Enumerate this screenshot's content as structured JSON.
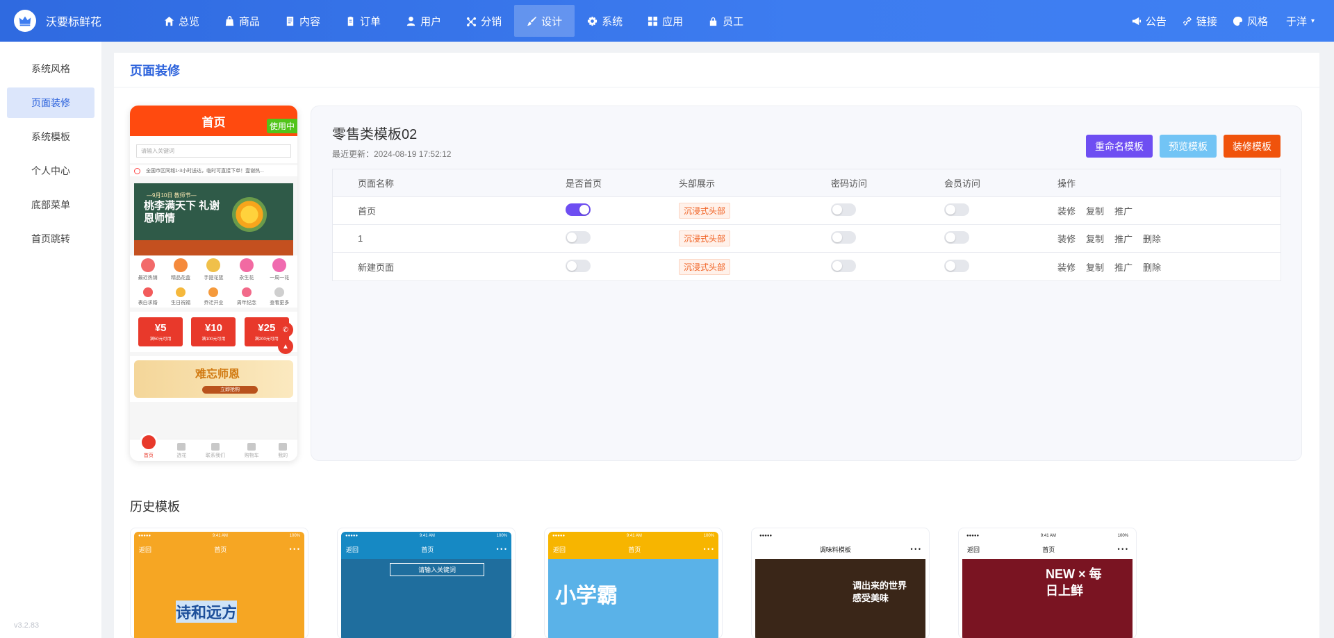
{
  "brand": {
    "name": "沃要标鲜花"
  },
  "nav": [
    {
      "label": "总览",
      "icon": "home-icon"
    },
    {
      "label": "商品",
      "icon": "bag-icon"
    },
    {
      "label": "内容",
      "icon": "document-icon"
    },
    {
      "label": "订单",
      "icon": "clipboard-icon"
    },
    {
      "label": "用户",
      "icon": "user-icon"
    },
    {
      "label": "分销",
      "icon": "share-icon"
    },
    {
      "label": "设计",
      "icon": "brush-icon"
    },
    {
      "label": "系统",
      "icon": "gear-icon"
    },
    {
      "label": "应用",
      "icon": "grid-icon"
    },
    {
      "label": "员工",
      "icon": "lock-icon"
    }
  ],
  "topRight": [
    {
      "label": "公告",
      "icon": "megaphone-icon"
    },
    {
      "label": "链接",
      "icon": "link-icon"
    },
    {
      "label": "风格",
      "icon": "palette-icon"
    }
  ],
  "user": {
    "name": "于洋"
  },
  "sidebar": {
    "items": [
      {
        "label": "系统风格"
      },
      {
        "label": "页面装修"
      },
      {
        "label": "系统模板"
      },
      {
        "label": "个人中心"
      },
      {
        "label": "底部菜单"
      },
      {
        "label": "首页跳转"
      }
    ],
    "version": "v3.2.83"
  },
  "page": {
    "title": "页面装修"
  },
  "phone": {
    "title": "首页",
    "badge": "使用中",
    "searchPlaceholder": "请输入关键词",
    "notice": "全国市区同城1-3小时送达，临时可直接下单！壹谢热...",
    "bannerSmall": "—9月10日 教师节—",
    "bannerBig": "桃李满天下 礼谢恩师情",
    "categories": [
      "最近热销",
      "精品花盒",
      "手提花篮",
      "永生花",
      "一周一花",
      "表白求婚",
      "生日祝福",
      "乔迁开业",
      "周年纪念",
      "查看更多"
    ],
    "categoryColors": [
      "#f26a6a",
      "#f58a3c",
      "#f0c04a",
      "#f26aa2",
      "#f06bb0",
      "#f25b5b",
      "#f5b83c",
      "#f59a3c",
      "#f26a8a",
      "#cfcfcf"
    ],
    "coupons": [
      {
        "value": "¥5",
        "cond": "满50元可用"
      },
      {
        "value": "¥10",
        "cond": "满100元可用"
      },
      {
        "value": "¥25",
        "cond": "满200元可用"
      }
    ],
    "promo": {
      "text": "难忘师恩",
      "button": "立即抢购"
    },
    "tabs": [
      "首页",
      "选花",
      "联系我们",
      "购物车",
      "我的"
    ]
  },
  "template": {
    "name": "零售类模板02",
    "updated": "最近更新：2024-08-19 17:52:12",
    "buttons": {
      "rename": "重命名模板",
      "preview": "预览模板",
      "decorate": "装修模板"
    },
    "columns": [
      "页面名称",
      "是否首页",
      "头部展示",
      "密码访问",
      "会员访问",
      "操作"
    ],
    "rows": [
      {
        "name": "首页",
        "home": true,
        "header": "沉浸式头部",
        "password": false,
        "member": false,
        "ops": [
          "装修",
          "复制",
          "推广"
        ]
      },
      {
        "name": "1",
        "home": false,
        "header": "沉浸式头部",
        "password": false,
        "member": false,
        "ops": [
          "装修",
          "复制",
          "推广",
          "删除"
        ]
      },
      {
        "name": "新建页面",
        "home": false,
        "header": "沉浸式头部",
        "password": false,
        "member": false,
        "ops": [
          "装修",
          "复制",
          "推广",
          "删除"
        ]
      }
    ]
  },
  "history": {
    "title": "历史模板",
    "cards": [
      {
        "time": "9:41 AM",
        "battery": "100%",
        "back": "返回",
        "title": "首页",
        "text": "诗和远方",
        "bg": "#f6a623",
        "headerColor": "#f6a623"
      },
      {
        "time": "9:41 AM",
        "battery": "100%",
        "back": "返回",
        "title": "首页",
        "text": "请输入关键词",
        "bg": "#1f6e9e",
        "headerColor": "#1689c4"
      },
      {
        "time": "9:41 AM",
        "battery": "100%",
        "back": "返回",
        "title": "首页",
        "text": "小学霸",
        "bg": "#5ab2e8",
        "headerColor": "#f7b500"
      },
      {
        "time": "",
        "battery": "",
        "back": "",
        "title": "调味料模板",
        "text": "调出来的世界 感受美味",
        "bg": "#3a2618",
        "headerColor": "#ffffff"
      },
      {
        "time": "9:41 AM",
        "battery": "100%",
        "back": "返回",
        "title": "首页",
        "text": "NEW × 每日上鲜",
        "bg": "#7a1422",
        "headerColor": "#ffffff"
      }
    ]
  }
}
